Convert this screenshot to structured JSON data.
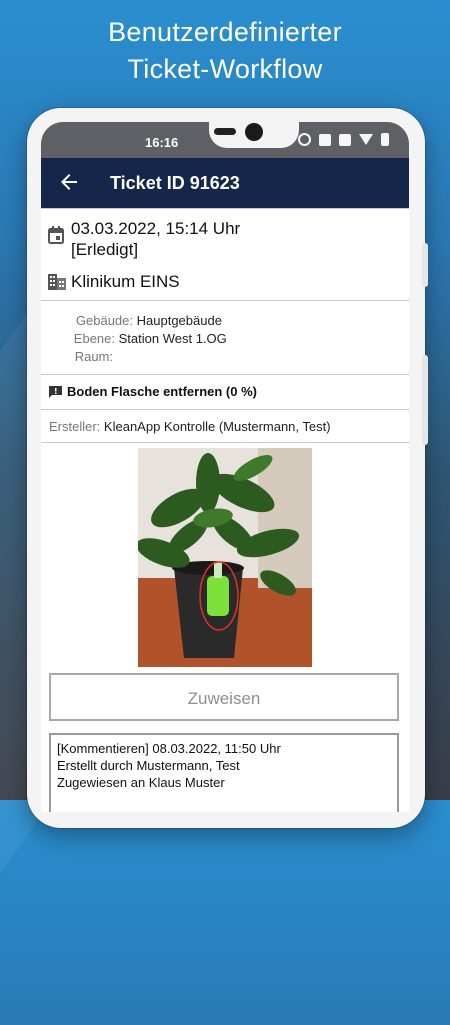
{
  "headline": {
    "line1": "Benutzerdefinierter",
    "line2": "Ticket-Workflow"
  },
  "statusbar": {
    "time": "16:16",
    "icons": [
      "alarm-icon",
      "nfc-icon",
      "volte-icon",
      "wifi-icon",
      "battery-icon"
    ]
  },
  "toolbar": {
    "title": "Ticket ID 91623",
    "back_icon": "arrow-back-icon"
  },
  "ticket": {
    "datetime": "03.03.2022, 15:14 Uhr",
    "status": "[Erledigt]",
    "client": "Klinikum EINS",
    "location": {
      "building_label": "Gebäude:",
      "building_value": "Hauptgebäude",
      "level_label": "Ebene:",
      "level_value": "Station West 1.OG",
      "room_label": "Raum:",
      "room_value": ""
    },
    "task": "Boden Flasche entfernen (0 %)",
    "creator_label": "Ersteller:",
    "creator_value": "KleanApp Kontrolle (Mustermann, Test)"
  },
  "actions": {
    "assign_label": "Zuweisen"
  },
  "comments": {
    "line1": "[Kommentieren] 08.03.2022, 11:50 Uhr",
    "line2": "Erstellt durch Mustermann, Test",
    "line3": "Zugewiesen an Klaus Muster"
  },
  "colors": {
    "toolbar": "#14274a",
    "statusbar": "#5f6065",
    "background_top": "#2a8fd0"
  }
}
